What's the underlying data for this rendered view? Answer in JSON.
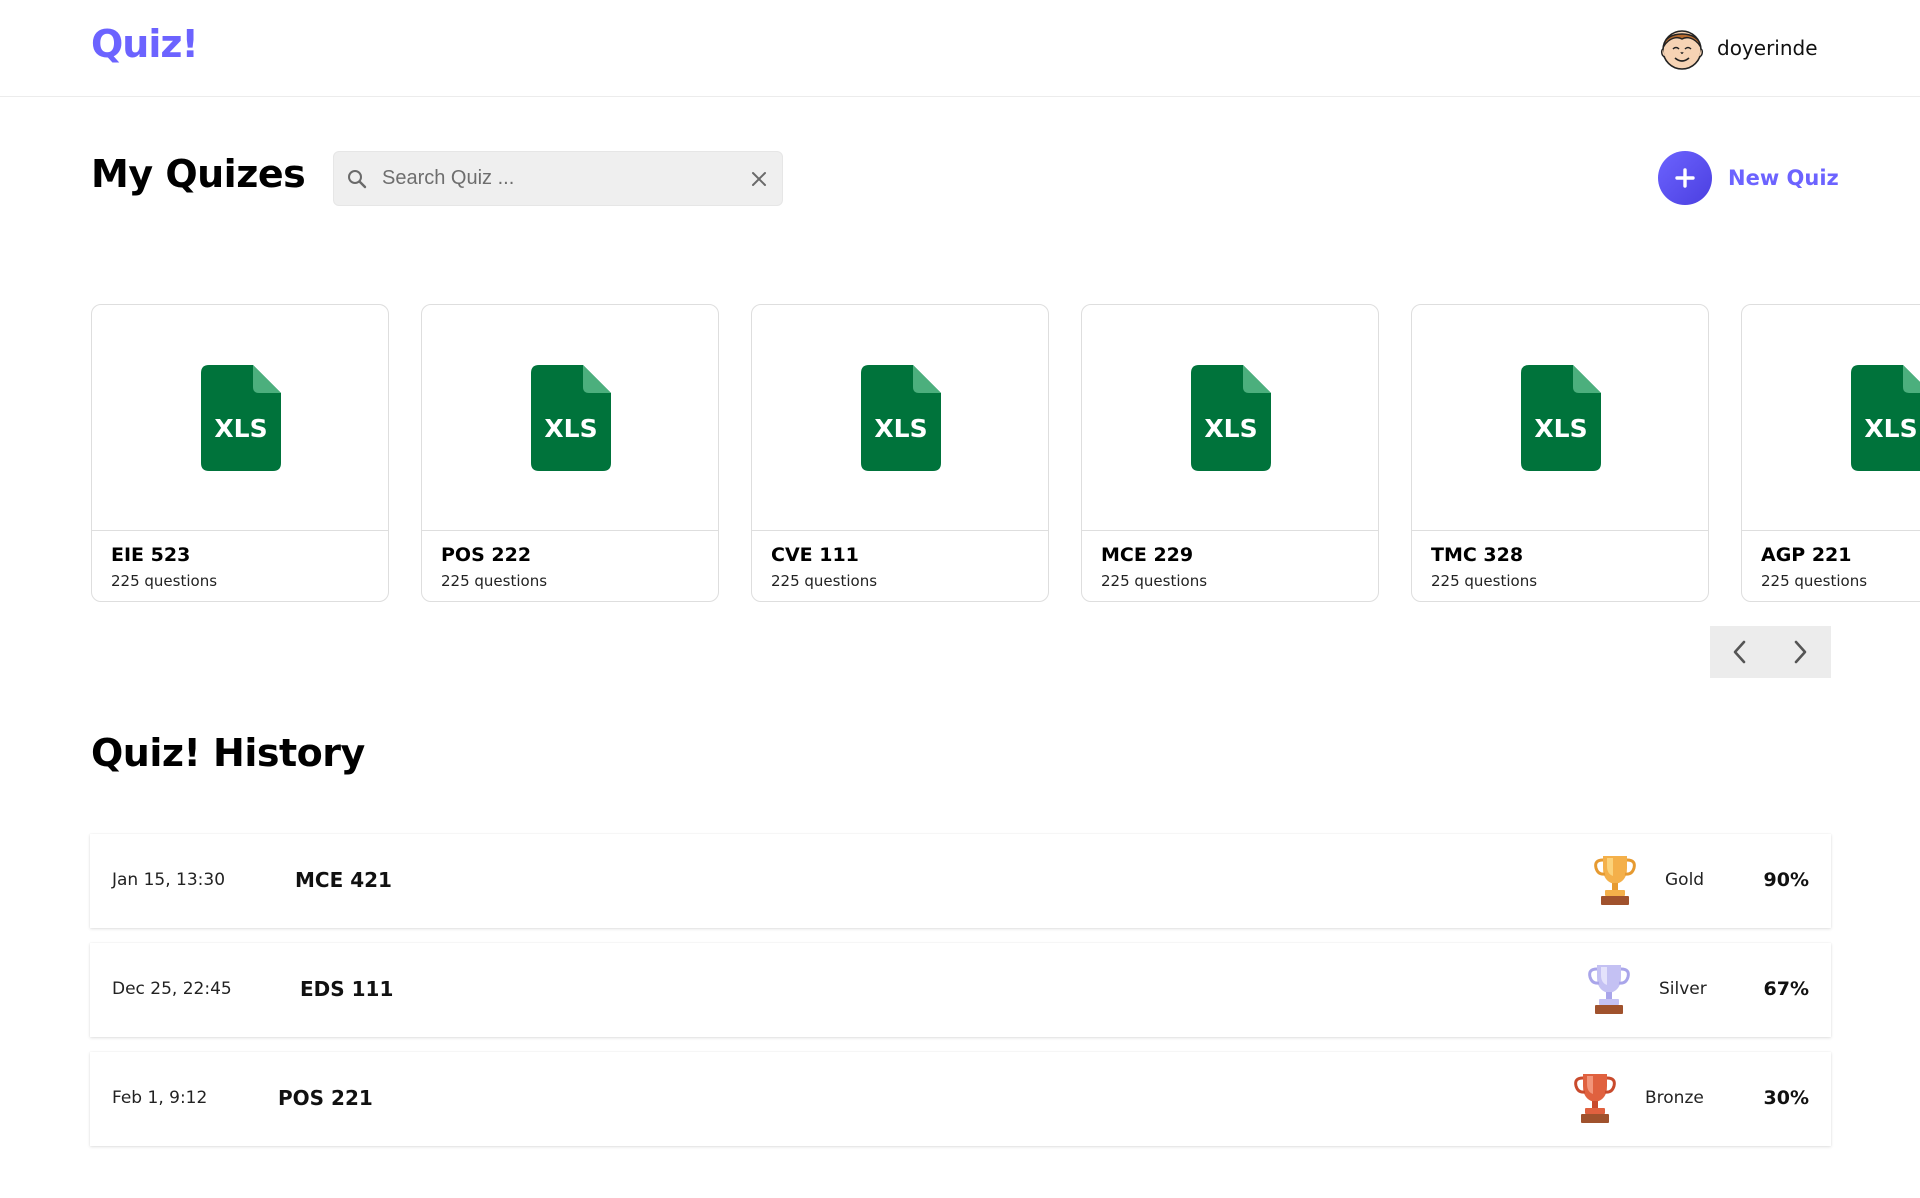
{
  "header": {
    "logo": "Quiz!",
    "username": "doyerinde"
  },
  "main": {
    "title": "My Quizes",
    "search": {
      "placeholder": "Search Quiz ...",
      "value": ""
    },
    "new_quiz_label": "New Quiz",
    "quizzes": [
      {
        "icon_label": "XLS",
        "title": "EIE 523",
        "subtitle": "225 questions"
      },
      {
        "icon_label": "XLS",
        "title": "POS 222",
        "subtitle": "225 questions"
      },
      {
        "icon_label": "XLS",
        "title": "CVE 111",
        "subtitle": "225 questions"
      },
      {
        "icon_label": "XLS",
        "title": "MCE 229",
        "subtitle": "225 questions"
      },
      {
        "icon_label": "XLS",
        "title": "TMC 328",
        "subtitle": "225 questions"
      },
      {
        "icon_label": "XLS",
        "title": "AGP 221",
        "subtitle": "225 questions"
      }
    ]
  },
  "history": {
    "title": "Quiz! History",
    "rows": [
      {
        "date": "Jan 15, 13:30",
        "course": "MCE 421",
        "medal": "Gold",
        "score": "90%"
      },
      {
        "date": "Dec 25, 22:45",
        "course": "EDS 111",
        "medal": "Silver",
        "score": "67%"
      },
      {
        "date": "Feb 1, 9:12",
        "course": "POS 221",
        "medal": "Bronze",
        "score": "30%"
      }
    ]
  },
  "colors": {
    "brand": "#6c63ff",
    "excel_green": "#00733b",
    "gold": "#f0a83a",
    "silver": "#b9b6f0",
    "bronze": "#d8553a"
  },
  "icons": {
    "logo_user": "avatar-face",
    "search": "search-icon",
    "clear": "close-icon",
    "add": "plus-icon",
    "file": "xls-file-icon",
    "prev": "chevron-left-icon",
    "next": "chevron-right-icon",
    "award": "trophy-icon"
  }
}
